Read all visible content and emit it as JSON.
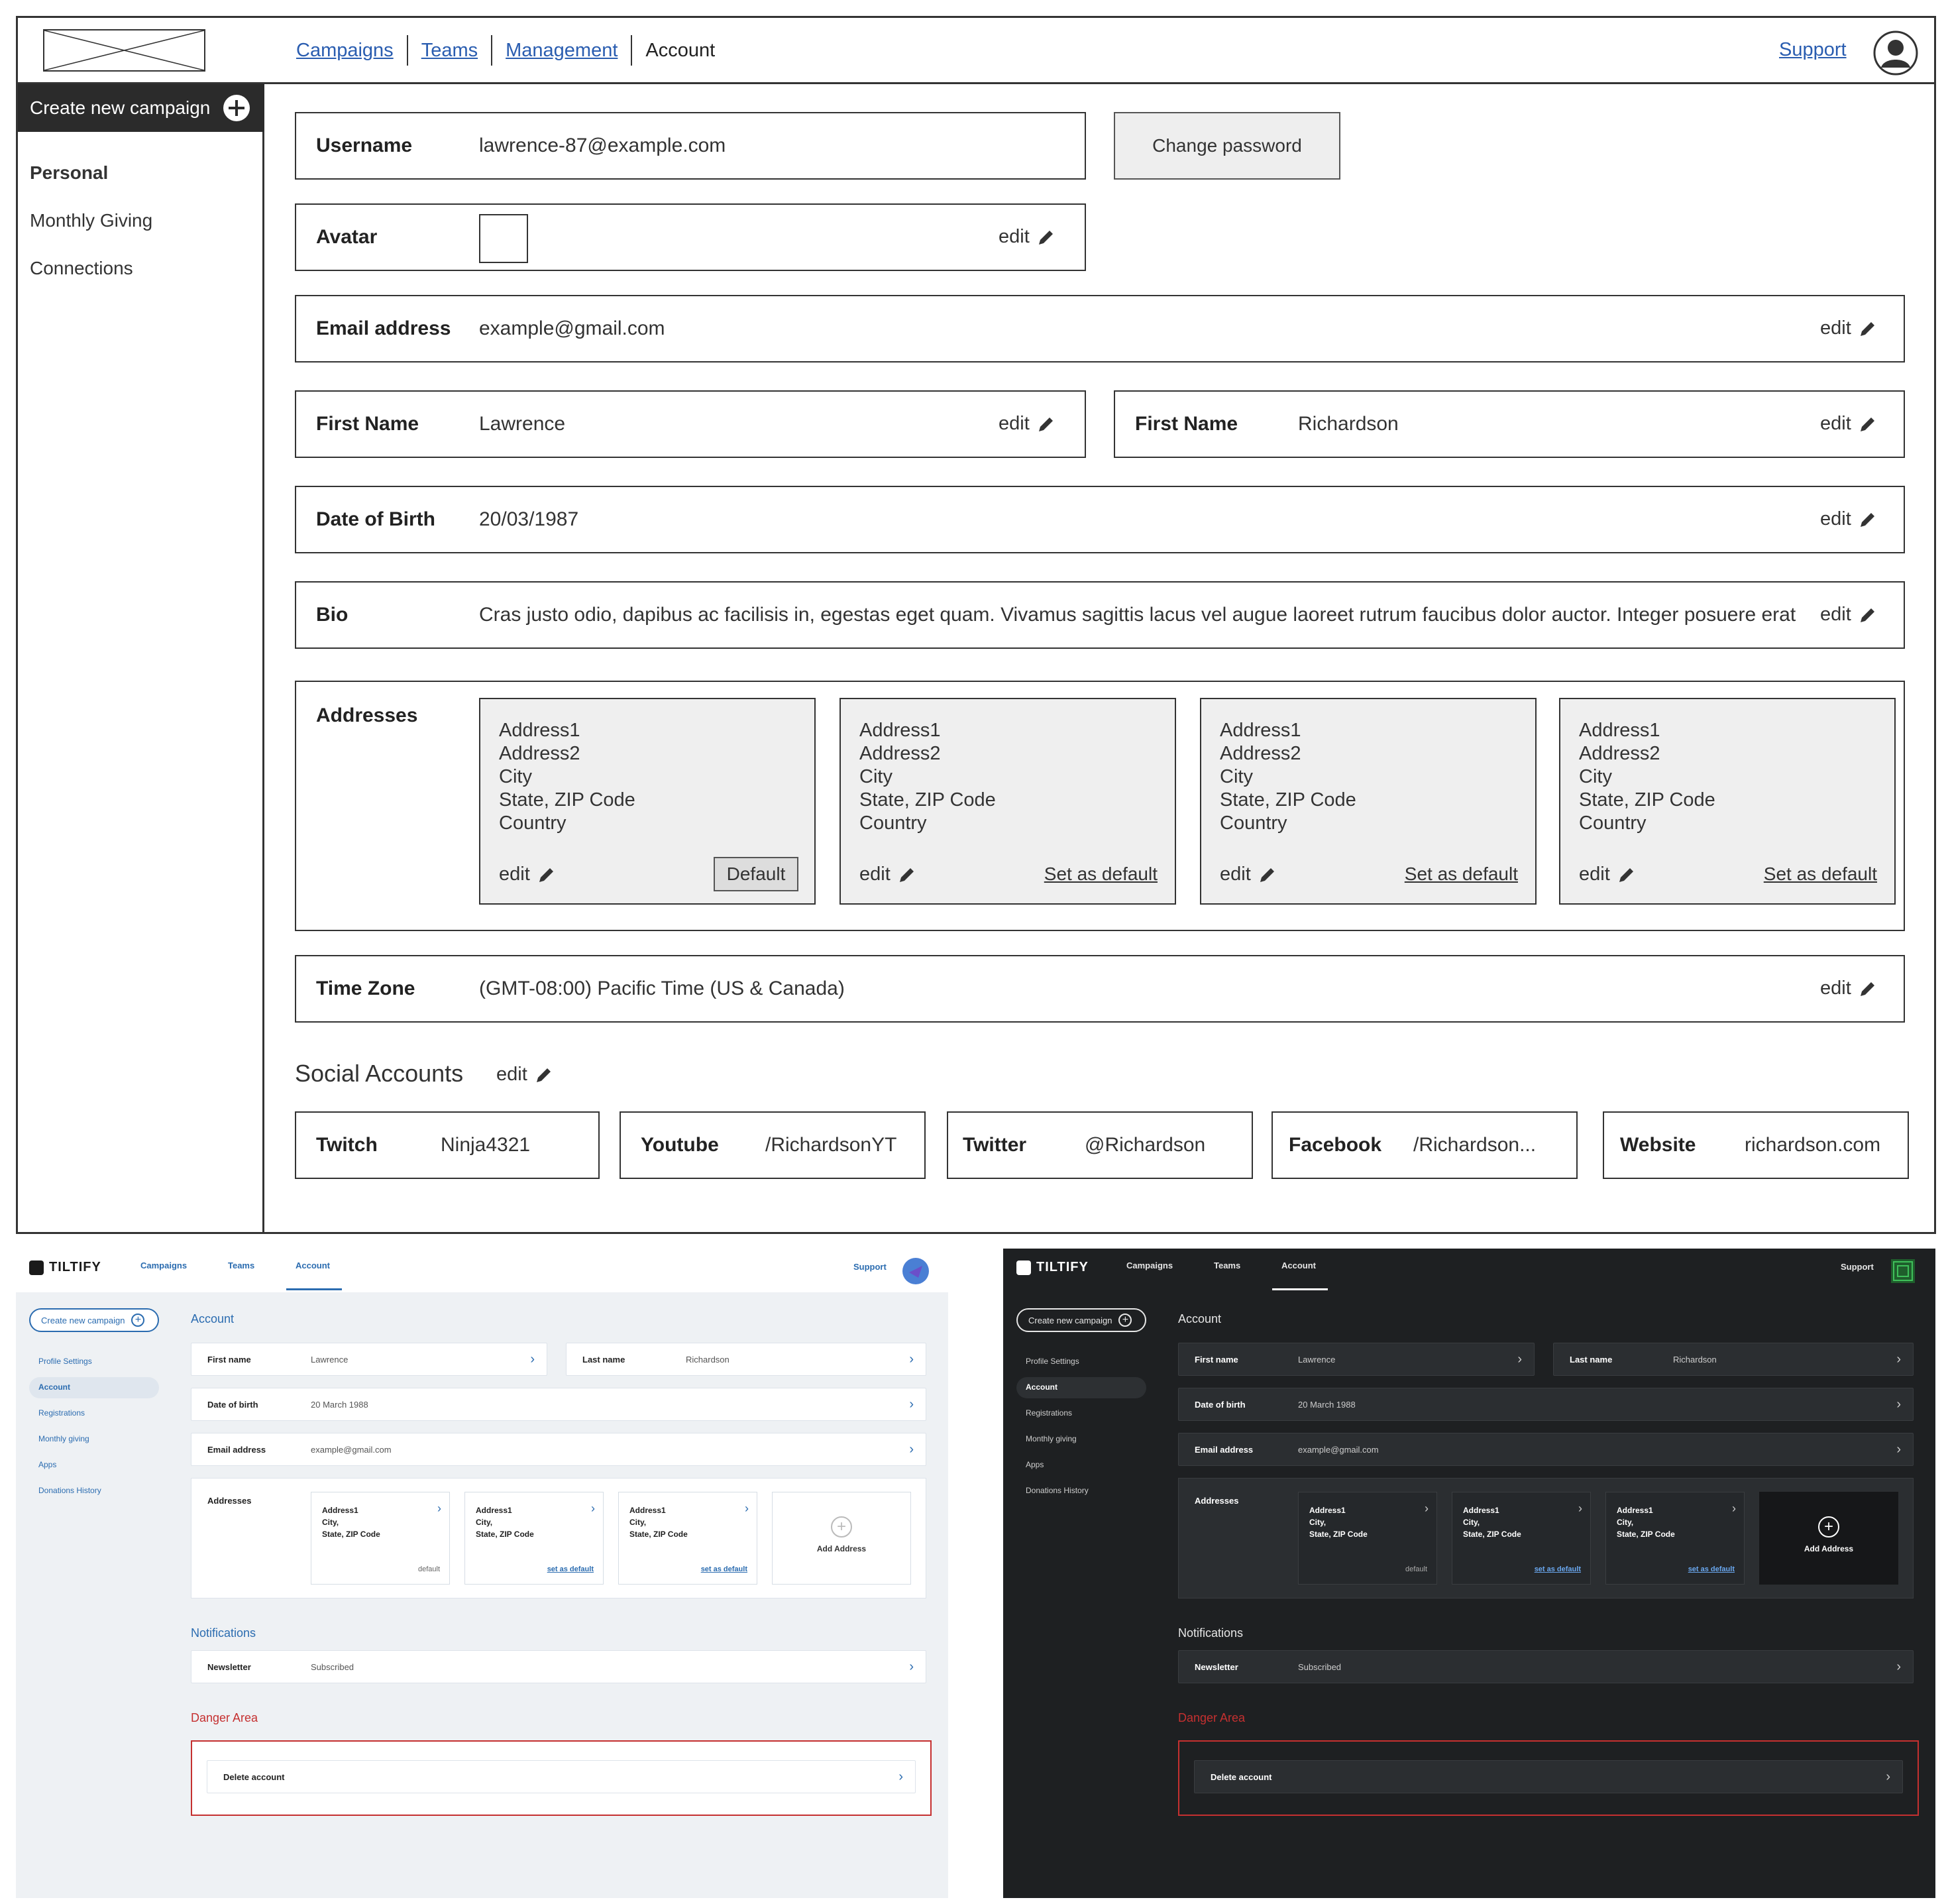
{
  "wireframe": {
    "nav": [
      "Campaigns",
      "Teams",
      "Management",
      "Account"
    ],
    "support": "Support",
    "create_campaign": "Create new campaign",
    "sidebar": [
      "Personal",
      "Monthly Giving",
      "Connections"
    ],
    "edit": "edit",
    "username": {
      "label": "Username",
      "value": "lawrence-87@example.com"
    },
    "change_password": "Change password",
    "avatar": {
      "label": "Avatar"
    },
    "email": {
      "label": "Email address",
      "value": "example@gmail.com"
    },
    "first_name": {
      "label": "First Name",
      "value": "Lawrence"
    },
    "last_name": {
      "label": "First Name",
      "value": "Richardson"
    },
    "dob": {
      "label": "Date of Birth",
      "value": "20/03/1987"
    },
    "bio": {
      "label": "Bio",
      "value": "Cras justo odio, dapibus ac facilisis in, egestas eget quam. Vivamus sagittis lacus vel augue laoreet rutrum faucibus dolor auctor. Integer posuere erat a"
    },
    "addresses": {
      "label": "Addresses",
      "lines": [
        "Address1",
        "Address2",
        "City",
        "State, ZIP Code",
        "Country"
      ],
      "default_label": "Default",
      "set_default": "Set as default"
    },
    "timezone": {
      "label": "Time Zone",
      "value": "(GMT-08:00) Pacific Time (US & Canada)"
    },
    "social": {
      "title": "Social Accounts",
      "items": [
        {
          "label": "Twitch",
          "value": "Ninja4321"
        },
        {
          "label": "Youtube",
          "value": "/RichardsonYT"
        },
        {
          "label": "Twitter",
          "value": "@Richardson"
        },
        {
          "label": "Facebook",
          "value": "/Richardson..."
        },
        {
          "label": "Website",
          "value": "richardson.com"
        }
      ]
    }
  },
  "mockup": {
    "logo": "TILTIFY",
    "nav": [
      "Campaigns",
      "Teams",
      "Account"
    ],
    "support": "Support",
    "create_campaign": "Create new campaign",
    "sidebar": [
      "Profile Settings",
      "Account",
      "Registrations",
      "Monthly giving",
      "Apps",
      "Donations History"
    ],
    "heading": "Account",
    "first_name": {
      "label": "First name",
      "value": "Lawrence"
    },
    "last_name": {
      "label": "Last name",
      "value": "Richardson"
    },
    "dob": {
      "label": "Date of birth",
      "value": "20 March 1988"
    },
    "email": {
      "label": "Email address",
      "value": "example@gmail.com"
    },
    "addresses": {
      "label": "Addresses",
      "lines": [
        "Address1",
        "City,",
        "State, ZIP Code"
      ],
      "default": "default",
      "set_default": "set as default",
      "add": "Add Address"
    },
    "notifications": "Notifications",
    "newsletter": {
      "label": "Newsletter",
      "value": "Subscribed"
    },
    "danger": "Danger Area",
    "delete": "Delete account",
    "colors": {
      "accent": "#2b6cb0",
      "danger": "#c53030",
      "dark_bg": "#1e2022",
      "light_bg": "#eef1f4"
    }
  }
}
